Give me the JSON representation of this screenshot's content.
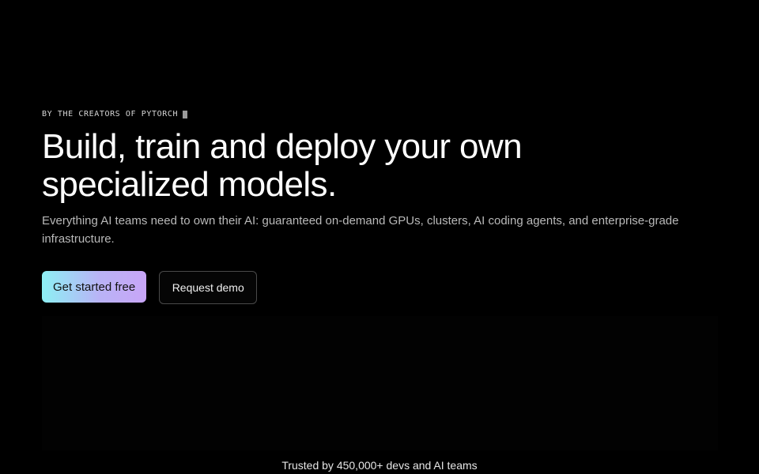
{
  "hero": {
    "eyebrow": "BY THE CREATORS OF PYTORCH",
    "headline_line1": "Build, train and deploy your own",
    "headline_line2": "specialized models.",
    "subtext": "Everything AI teams need to own their AI: guaranteed on-demand GPUs, clusters, AI coding agents, and enterprise-grade infrastructure.",
    "primary_cta": "Get started free",
    "secondary_cta": "Request demo"
  },
  "trusted": {
    "text": "Trusted by 450,000+ devs and AI teams"
  },
  "colors": {
    "background": "#000000",
    "cta_gradient_start": "#8df0f4",
    "cta_gradient_end": "#c8a5f7"
  }
}
